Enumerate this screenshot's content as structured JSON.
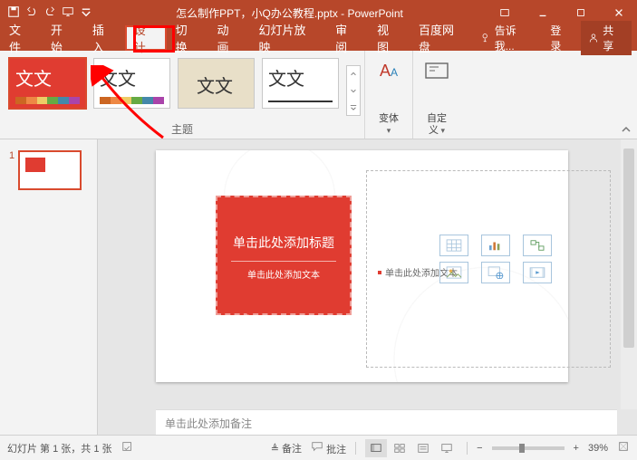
{
  "titlebar": {
    "doc_title": "怎么制作PPT，小Q办公教程.pptx - PowerPoint"
  },
  "tabs": {
    "file": "文件",
    "home": "开始",
    "insert": "插入",
    "design": "设计",
    "transitions": "切换",
    "animations": "动画",
    "slideshow": "幻灯片放映",
    "review": "审阅",
    "view": "视图",
    "baidu": "百度网盘",
    "tell_me": "告诉我...",
    "signin": "登录",
    "share": "共享"
  },
  "ribbon": {
    "themes_label": "主题",
    "variants_label": "变体",
    "customize_label": "自定\n义",
    "theme_text": "文文"
  },
  "slide": {
    "number": "1",
    "title_placeholder": "单击此处添加标题",
    "subtitle_placeholder": "单击此处添加文本",
    "content_placeholder": "单击此处添加文本",
    "notes_placeholder": "单击此处添加备注"
  },
  "statusbar": {
    "slide_counter": "幻灯片 第 1 张，共 1 张",
    "notes_btn": "备注",
    "comments_btn": "批注",
    "zoom_pct": "39%"
  }
}
